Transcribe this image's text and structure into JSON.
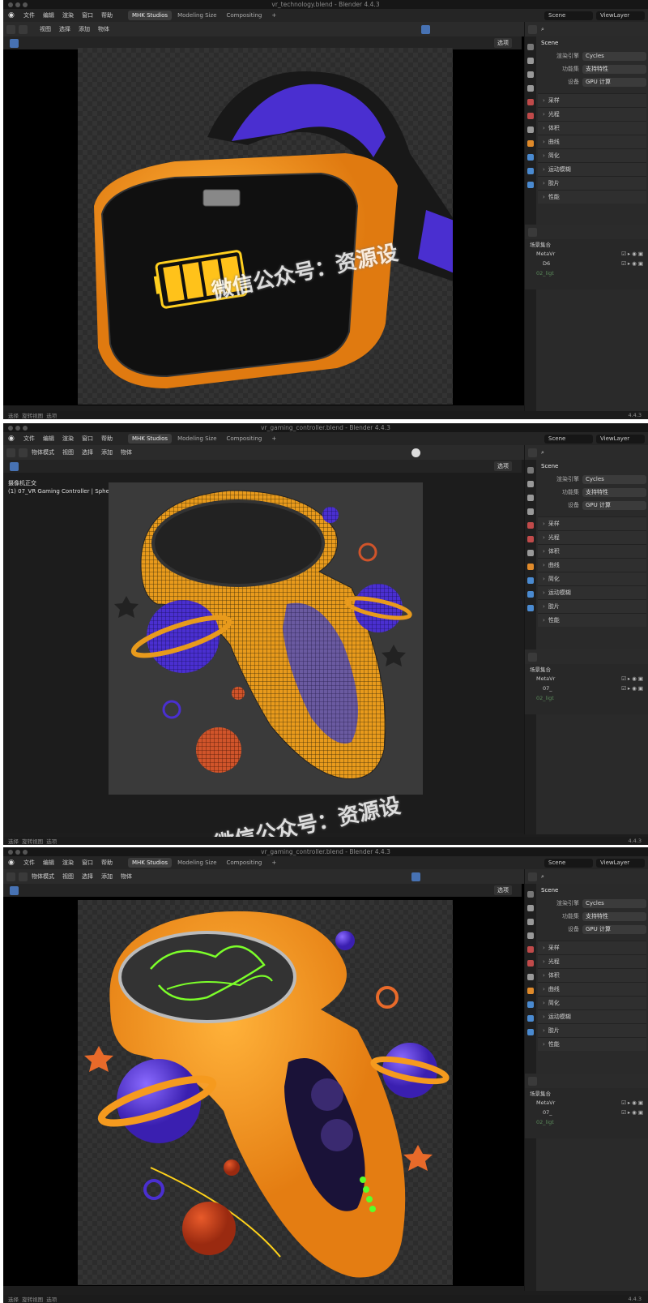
{
  "screens": [
    {
      "title": "vr_technology.blend - Blender 4.4.3",
      "viewport_overlay": [
        "",
        ""
      ],
      "mode": "",
      "view_mode": "选项",
      "version": "4.4.3"
    },
    {
      "title": "vr_gaming_controller.blend - Blender 4.4.3",
      "viewport_overlay": [
        "摄像机正交",
        "(1) 07_VR Gaming Controller | Sphere.006"
      ],
      "mode": "物体模式",
      "view_mode": "选项",
      "version": "4.4.3"
    },
    {
      "title": "vr_gaming_controller.blend - Blender 4.4.3",
      "viewport_overlay": [
        "",
        ""
      ],
      "mode": "物体模式",
      "view_mode": "选项",
      "version": "4.4.3"
    }
  ],
  "menu": [
    "文件",
    "编辑",
    "渲染",
    "窗口",
    "帮助"
  ],
  "workspaces": [
    "MHK Studios",
    "Modeling Size",
    "Compositing",
    "+"
  ],
  "header_menu": [
    "视图",
    "选择",
    "添加",
    "物体"
  ],
  "scene": {
    "label": "Scene",
    "viewlayer": "ViewLayer"
  },
  "properties": {
    "title": "Scene",
    "rows": [
      {
        "label": "渲染引擎",
        "value": "Cycles"
      },
      {
        "label": "功能集",
        "value": "支持特性"
      },
      {
        "label": "设备",
        "value": "GPU 计算"
      }
    ],
    "sections": [
      "采样",
      "光程",
      "体积",
      "曲线",
      "简化",
      "运动模糊",
      "胶片",
      "性能"
    ]
  },
  "outliner": {
    "rows": [
      "场景集合",
      "MetaVr",
      "D6",
      "02_ligt"
    ],
    "rows_alt": [
      "场景集合",
      "MetaVr",
      "07_",
      "02_ligt"
    ]
  },
  "status": [
    "选择",
    "旋转视图",
    "选项"
  ],
  "watermark": "微信公众号：资源设",
  "colors": {
    "accent": "#4772b3",
    "orange": "#f59a1e",
    "purple": "#4a2fd0"
  }
}
